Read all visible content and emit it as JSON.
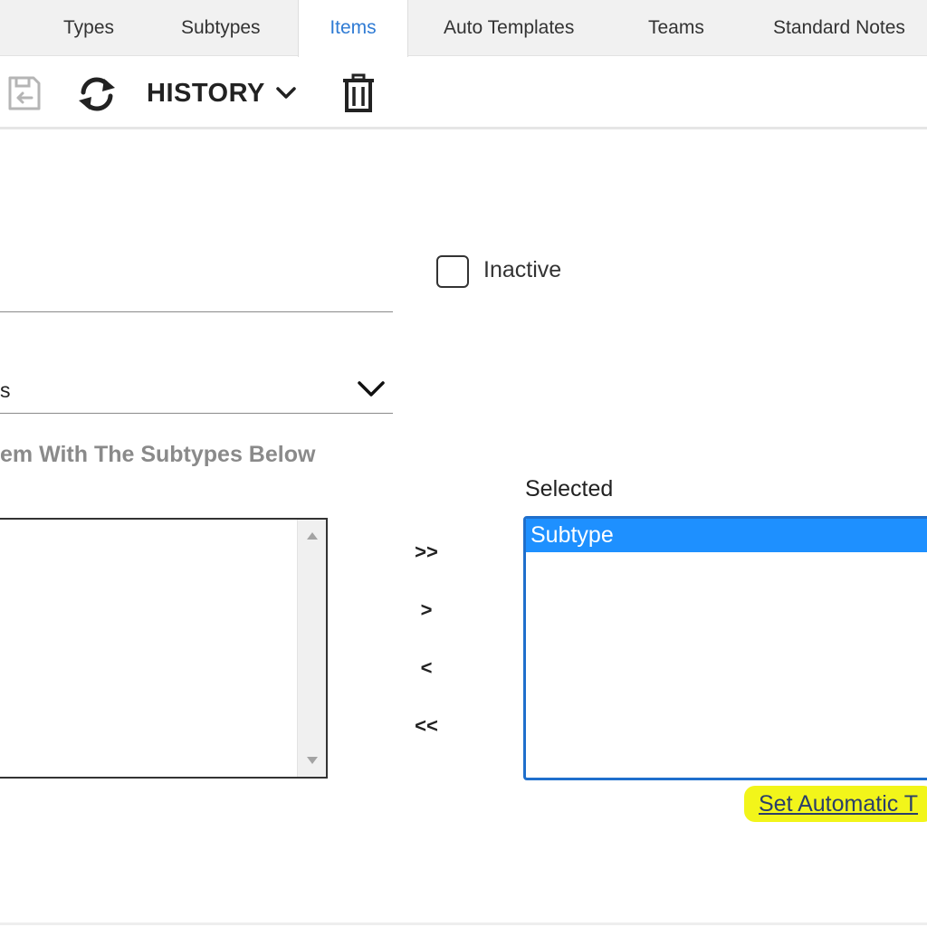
{
  "tabs": [
    {
      "label": "Types",
      "active": false
    },
    {
      "label": "Subtypes",
      "active": false
    },
    {
      "label": "Items",
      "active": true
    },
    {
      "label": "Auto Templates",
      "active": false
    },
    {
      "label": "Teams",
      "active": false
    },
    {
      "label": "Standard Notes",
      "active": false
    }
  ],
  "toolbar": {
    "save_icon": "save-icon",
    "refresh_icon": "refresh-icon",
    "history_label": "HISTORY",
    "history_caret_icon": "chevron-down-icon",
    "delete_icon": "trash-icon"
  },
  "form": {
    "inactive_label": "Inactive",
    "inactive_checked": false,
    "select_visible_text": "s",
    "helper_text": "em With The Subtypes Below"
  },
  "transfer": {
    "add_all": ">>",
    "add_one": ">",
    "remove_one": "<",
    "remove_all": "<<"
  },
  "selected": {
    "label": "Selected",
    "options": [
      "Subtype"
    ]
  },
  "link": {
    "label": "Set Automatic T"
  },
  "colors": {
    "accent": "#2f7bd4",
    "selection": "#1e90ff",
    "highlight": "#f2f51a",
    "focus_border": "#1f6fcc"
  }
}
